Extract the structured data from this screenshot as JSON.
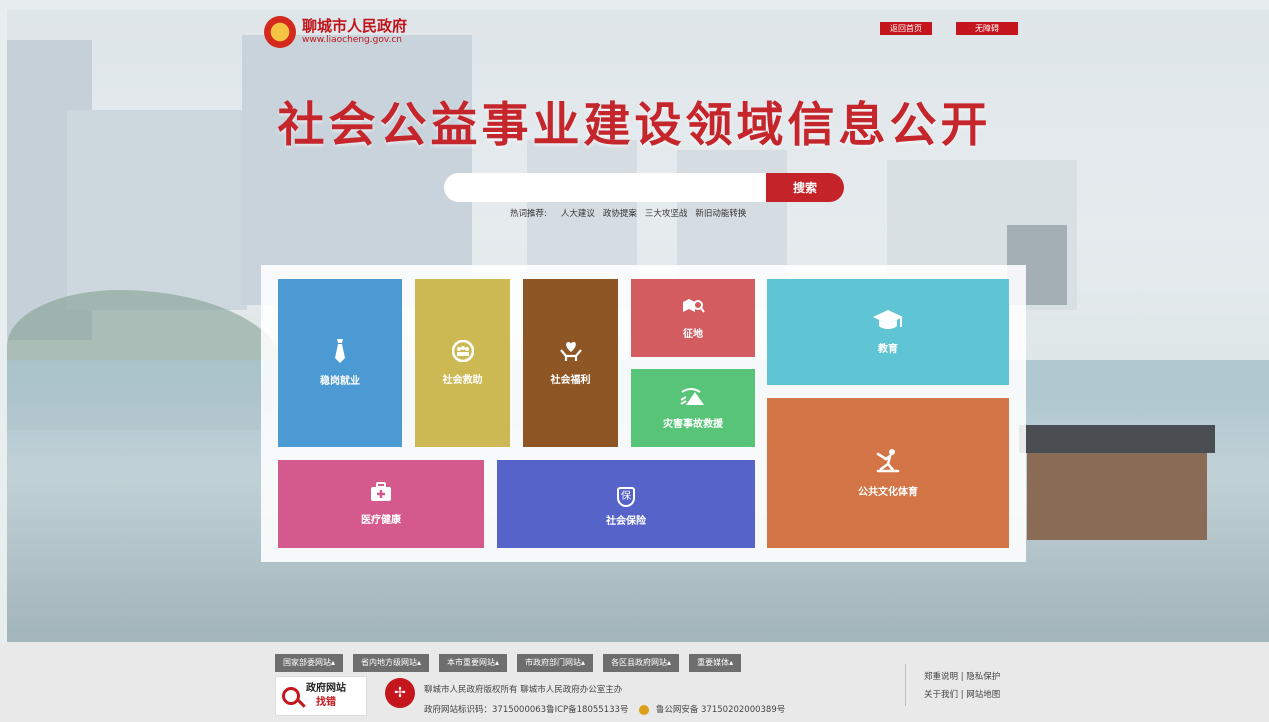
{
  "header": {
    "site_name": "聊城市人民政府",
    "site_url": "www.liaocheng.gov.cn",
    "home_button": "返回首页",
    "accessibility_button": "无障碍"
  },
  "main": {
    "title": "社会公益事业建设领域信息公开",
    "search_placeholder": "",
    "search_button": "搜索",
    "hot_label": "热词推荐:",
    "hot_words": [
      "人大建议",
      "政协提案",
      "三大攻坚战",
      "新旧动能转换"
    ]
  },
  "tiles": {
    "jobs": "稳岗就业",
    "aid": "社会救助",
    "welfare": "社会福利",
    "land": "征地",
    "education": "教育",
    "disaster": "灾害事故救援",
    "culture": "公共文化体育",
    "health": "医疗健康",
    "insurance": "社会保险",
    "insurance_icon_char": "保"
  },
  "footer": {
    "nav": [
      "国家部委网站▴",
      "省内地方级网站▴",
      "本市重要网站▴",
      "市政府部门网站▴",
      "各区县政府网站▴",
      "重要媒体▴"
    ],
    "find_bad_line1": "政府网站",
    "find_bad_line2": "找错",
    "copyright": "聊城市人民政府版权所有   聊城市人民政府办公室主办",
    "site_id": "政府网站标识码：3715000063鲁ICP备18055133号",
    "police_record": "鲁公网安备   37150202000389号",
    "links_row1": "郑重说明 | 隐私保护",
    "links_row2": "关于我们 | 网站地图"
  },
  "colors": {
    "brand_red": "#c4262c",
    "tile_jobs": "#4b9ad4",
    "tile_aid": "#cdb954",
    "tile_welfare": "#8d5624",
    "tile_land": "#d25c5f",
    "tile_education": "#5fc4d3",
    "tile_disaster": "#58c477",
    "tile_culture": "#d37546",
    "tile_health": "#d45a8d",
    "tile_insurance": "#5663c8"
  }
}
